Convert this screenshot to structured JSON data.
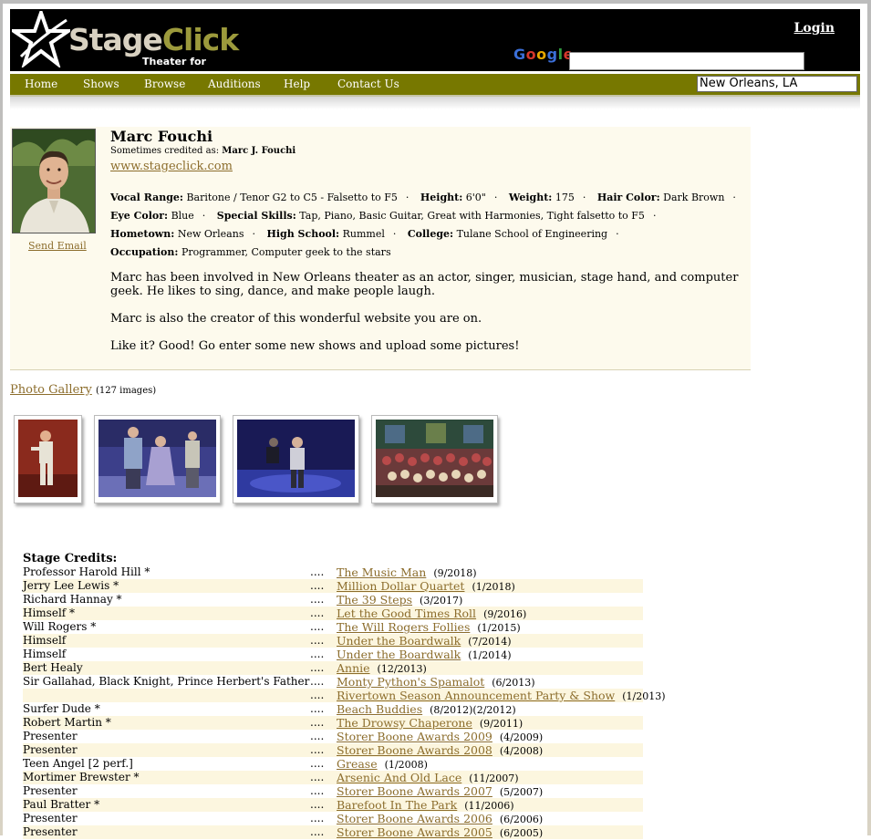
{
  "header": {
    "logo_stage": "Stage",
    "logo_click": "Click",
    "tagline": "Theater for everyone",
    "login_label": "Login",
    "google_label": "Google",
    "search_value": ""
  },
  "nav": {
    "items": [
      "Home",
      "Shows",
      "Browse",
      "Auditions",
      "Help",
      "Contact Us"
    ],
    "location_value": "New Orleans, LA"
  },
  "profile": {
    "name": "Marc Fouchi",
    "aka_label": "Sometimes credited as:",
    "aka_value": "Marc J. Fouchi",
    "website": "www.stageclick.com",
    "send_email_label": "Send Email",
    "facts": [
      {
        "label": "Vocal Range:",
        "value": "Baritone / Tenor G2 to C5 - Falsetto to F5"
      },
      {
        "label": "Height:",
        "value": "6'0\""
      },
      {
        "label": "Weight:",
        "value": "175"
      },
      {
        "label": "Hair Color:",
        "value": "Dark Brown"
      },
      {
        "label": "Eye Color:",
        "value": "Blue"
      },
      {
        "label": "Special Skills:",
        "value": "Tap, Piano, Basic Guitar, Great with Harmonies, Tight falsetto to F5"
      },
      {
        "label": "Hometown:",
        "value": "New Orleans"
      },
      {
        "label": "High School:",
        "value": "Rummel"
      },
      {
        "label": "College:",
        "value": "Tulane School of Engineering"
      },
      {
        "label": "Occupation:",
        "value": "Programmer, Computer geek to the stars"
      }
    ],
    "bio": [
      "Marc has been involved in New Orleans theater as an actor, singer, musician, stage hand, and computer geek. He likes to sing, dance, and make people laugh.",
      "Marc is also the creator of this wonderful website you are on.",
      "Like it? Good! Go enter some new shows and upload some pictures!"
    ]
  },
  "gallery": {
    "link_label": "Photo Gallery",
    "count_label": "(127 images)"
  },
  "credits": {
    "title": "Stage Credits:",
    "separator": "....",
    "rows": [
      {
        "role": "Professor Harold Hill *",
        "show": "The Music Man",
        "date": "(9/2018)"
      },
      {
        "role": "Jerry Lee Lewis *",
        "show": "Million Dollar Quartet",
        "date": "(1/2018)"
      },
      {
        "role": "Richard Hannay *",
        "show": "The 39 Steps",
        "date": "(3/2017)"
      },
      {
        "role": "Himself *",
        "show": "Let the Good Times Roll",
        "date": "(9/2016)"
      },
      {
        "role": "Will Rogers *",
        "show": "The Will Rogers Follies",
        "date": "(1/2015)"
      },
      {
        "role": "Himself",
        "show": "Under the Boardwalk",
        "date": "(7/2014)"
      },
      {
        "role": "Himself",
        "show": "Under the Boardwalk",
        "date": "(1/2014)"
      },
      {
        "role": "Bert Healy",
        "show": "Annie",
        "date": "(12/2013)"
      },
      {
        "role": "Sir Gallahad, Black Knight, Prince Herbert's Father",
        "show": "Monty Python's Spamalot",
        "date": "(6/2013)"
      },
      {
        "role": "",
        "show": "Rivertown Season Announcement Party & Show",
        "date": "(1/2013)"
      },
      {
        "role": "Surfer Dude *",
        "show": "Beach Buddies",
        "date": "(8/2012)(2/2012)"
      },
      {
        "role": "Robert Martin *",
        "show": "The Drowsy Chaperone",
        "date": "(9/2011)"
      },
      {
        "role": "Presenter",
        "show": "Storer Boone Awards 2009",
        "date": "(4/2009)"
      },
      {
        "role": "Presenter",
        "show": "Storer Boone Awards 2008",
        "date": "(4/2008)"
      },
      {
        "role": "Teen Angel [2 perf.]",
        "show": "Grease",
        "date": "(1/2008)"
      },
      {
        "role": "Mortimer Brewster *",
        "show": "Arsenic And Old Lace",
        "date": "(11/2007)"
      },
      {
        "role": "Presenter",
        "show": "Storer Boone Awards 2007",
        "date": "(5/2007)"
      },
      {
        "role": "Paul Bratter *",
        "show": "Barefoot In The Park",
        "date": "(11/2006)"
      },
      {
        "role": "Presenter",
        "show": "Storer Boone Awards 2006",
        "date": "(6/2006)"
      },
      {
        "role": "Presenter",
        "show": "Storer Boone Awards 2005",
        "date": "(6/2005)"
      }
    ]
  }
}
